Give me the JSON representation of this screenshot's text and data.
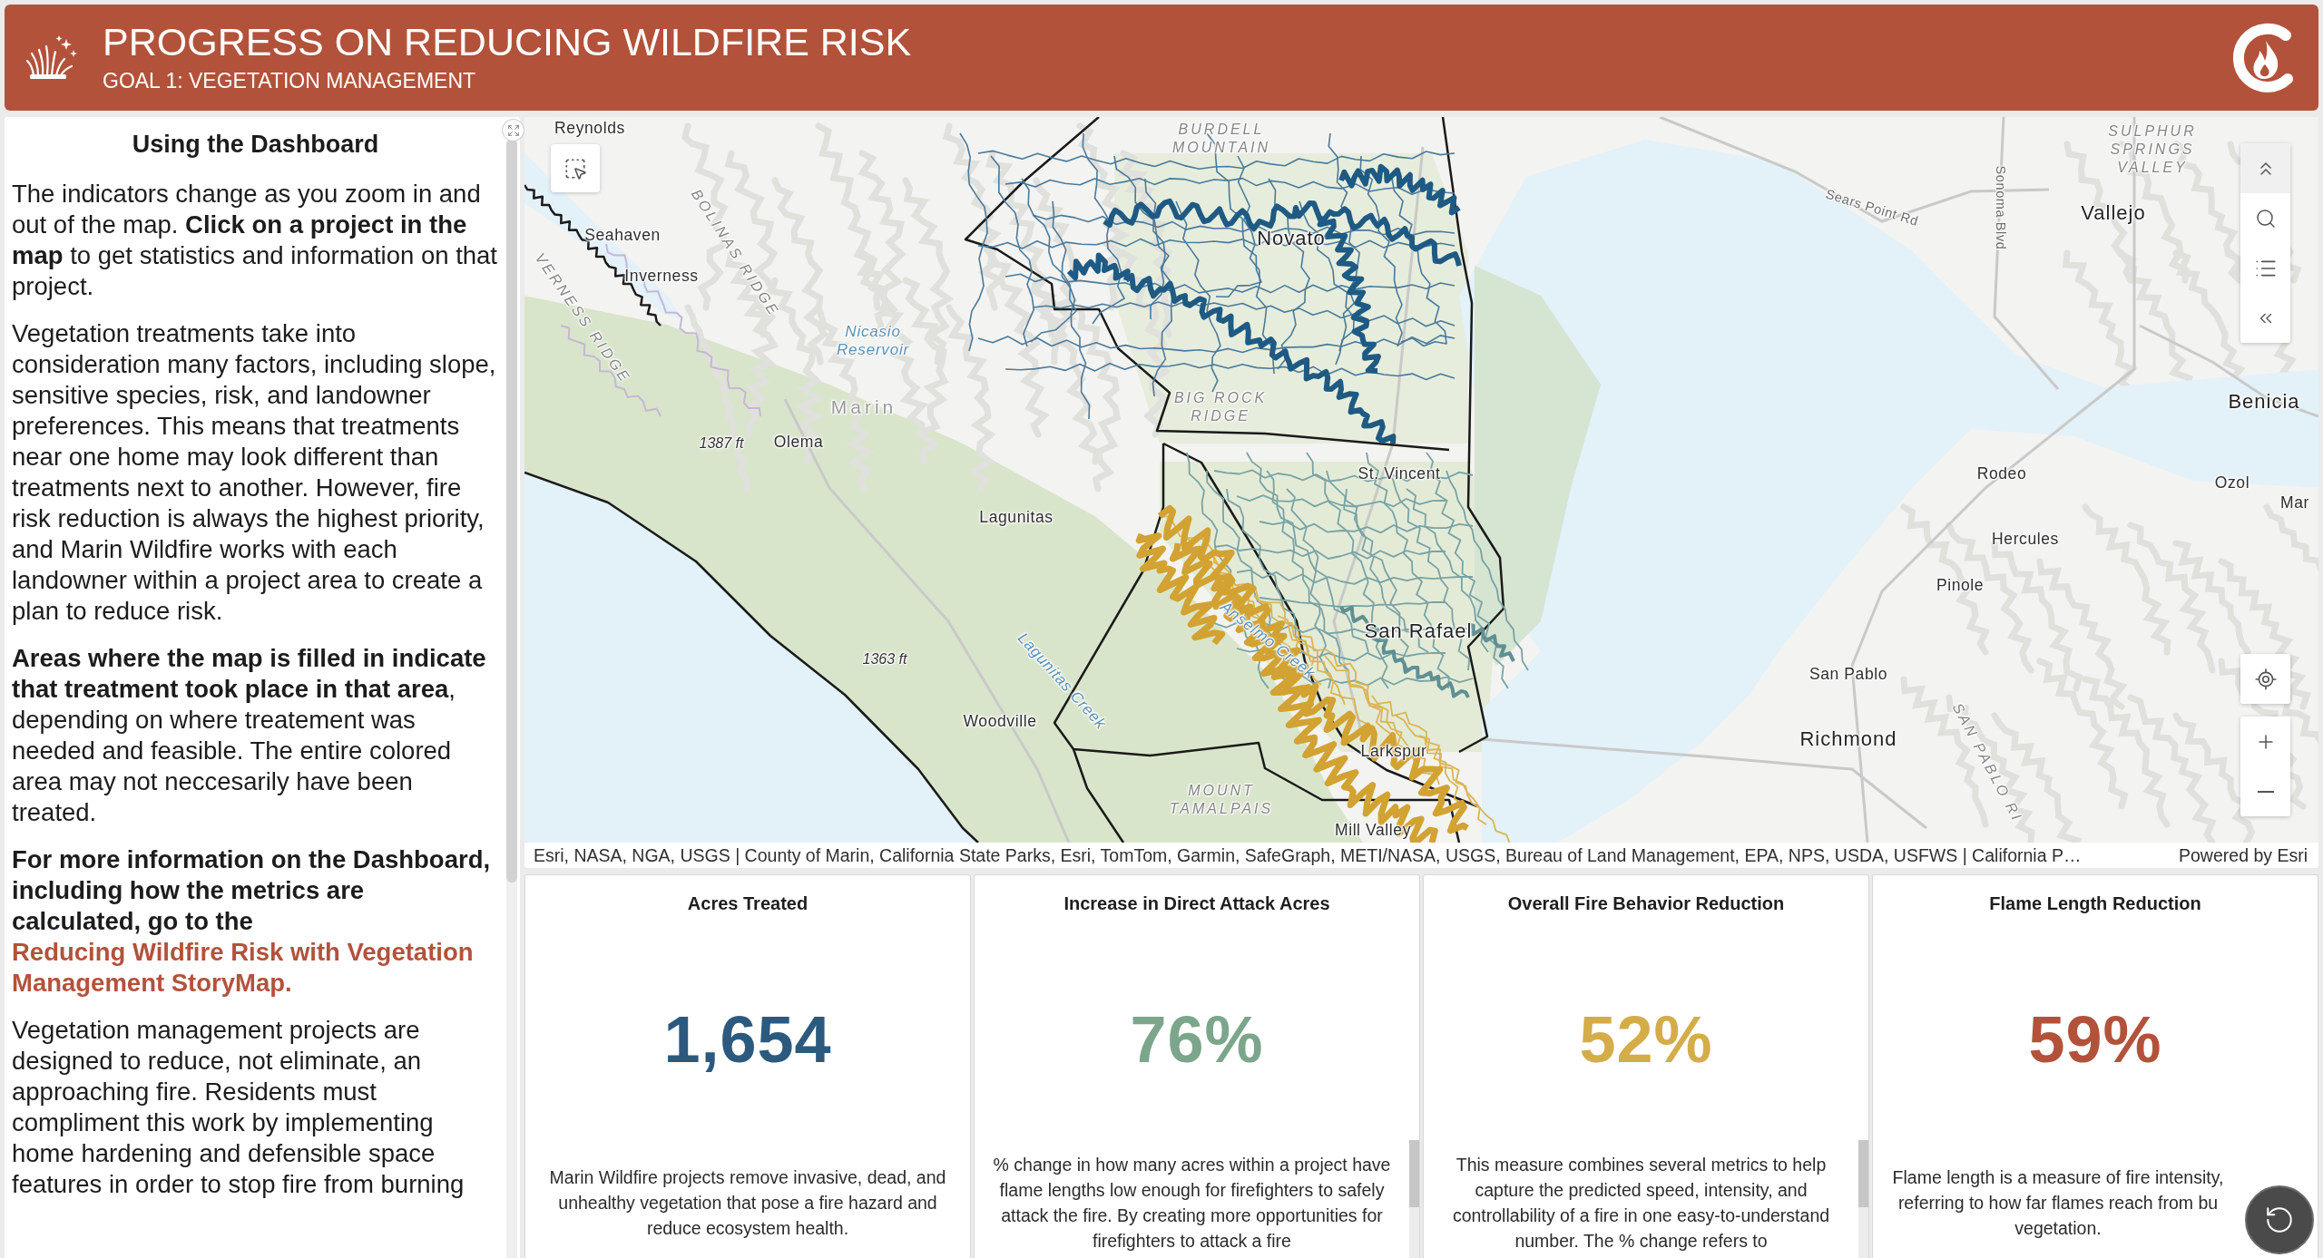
{
  "header": {
    "title": "PROGRESS ON REDUCING WILDFIRE RISK",
    "subtitle": "GOAL 1: VEGETATION MANAGEMENT"
  },
  "info_panel": {
    "heading": "Using the Dashboard",
    "paragraphs": [
      {
        "kind": "plain",
        "text": "The indicators change as you zoom in and out of the map. **Click on a project in the map** to get statistics and information on that project."
      },
      {
        "kind": "plain",
        "text": "Vegetation treatments take into consideration many factors, including slope, sensitive species, risk, and landowner preferences. This means that treatments near one home may look different than treatments next to another. However, fire risk reduction is always the highest priority, and Marin Wildfire works with each landowner within a project area to create a plan to reduce risk."
      },
      {
        "kind": "plain",
        "text": "**Areas where the map is filled in indicate that treatment took place in that area**, depending on where treatement was needed and feasible. The entire colored area may not neccesarily have been treated."
      },
      {
        "kind": "bold",
        "text": "For more information on the Dashboard, including how the metrics are calculated, go to the",
        "link": "Reducing Wildfire Risk with Vegetation Management StoryMap."
      },
      {
        "kind": "plain",
        "text": "Vegetation management projects are designed to reduce, not eliminate, an approaching fire. Residents must compliment this work by implementing home hardening and defensible space features in order to stop fire from burning"
      }
    ]
  },
  "map": {
    "labels": [
      {
        "text": "Reynolds",
        "kind": "town"
      },
      {
        "text": "BURDELL MOUNTAIN",
        "kind": "region"
      },
      {
        "text": "SULPHUR SPRINGS VALLEY",
        "kind": "region"
      },
      {
        "text": "Sears Point Rd",
        "kind": "road"
      },
      {
        "text": "Sonoma Blvd",
        "kind": "road"
      },
      {
        "text": "Vallejo",
        "kind": "city"
      },
      {
        "text": "Seahaven",
        "kind": "town"
      },
      {
        "text": "Novato",
        "kind": "city"
      },
      {
        "text": "BOLINAS RIDGE",
        "kind": "region"
      },
      {
        "text": "Inverness",
        "kind": "town"
      },
      {
        "text": "VERNESS RIDGE",
        "kind": "region"
      },
      {
        "text": "Nicasio Reservoir",
        "kind": "water"
      },
      {
        "text": "Marin",
        "kind": "county"
      },
      {
        "text": "BIG ROCK RIDGE",
        "kind": "region"
      },
      {
        "text": "Benicia",
        "kind": "city"
      },
      {
        "text": "Olema",
        "kind": "town"
      },
      {
        "text": "1387 ft",
        "kind": "elevation"
      },
      {
        "text": "St. Vincent",
        "kind": "town"
      },
      {
        "text": "Rodeo",
        "kind": "town"
      },
      {
        "text": "Ozol",
        "kind": "town"
      },
      {
        "text": "Mar",
        "kind": "town"
      },
      {
        "text": "Lagunitas",
        "kind": "town"
      },
      {
        "text": "Hercules",
        "kind": "town"
      },
      {
        "text": "Pinole",
        "kind": "town"
      },
      {
        "text": "San Rafael",
        "kind": "city"
      },
      {
        "text": "Anselmo Creek",
        "kind": "water"
      },
      {
        "text": "1363 ft",
        "kind": "elevation"
      },
      {
        "text": "San Pablo",
        "kind": "town"
      },
      {
        "text": "Lagunitas Creek",
        "kind": "water"
      },
      {
        "text": "Woodville",
        "kind": "town"
      },
      {
        "text": "Richmond",
        "kind": "city"
      },
      {
        "text": "Larkspur",
        "kind": "town"
      },
      {
        "text": "SAN PABLO RI",
        "kind": "region"
      },
      {
        "text": "MOUNT TAMALPAIS",
        "kind": "region"
      },
      {
        "text": "Mill Valley",
        "kind": "town"
      }
    ],
    "attribution": "Esri, NASA, NGA, USGS | County of Marin, California State Parks, Esri, TomTom, Garmin, SafeGraph, METI/NASA, USGS, Bureau of Land Management, EPA, NPS, USDA, USFWS | California P…",
    "powered_by": "Powered by Esri"
  },
  "metrics": [
    {
      "title": "Acres Treated",
      "value": "1,654",
      "color": "#2c5a7e",
      "description": "Marin Wildfire projects remove invasive, dead, and unhealthy vegetation that pose a fire hazard and reduce ecosystem health.",
      "scrollable": false
    },
    {
      "title": "Increase in Direct Attack Acres",
      "value": "76%",
      "color": "#7ba68c",
      "description": "% change in how many acres within a project have flame lengths low enough for firefighters to safely attack the fire. By creating more opportunities for firefighters to attack a fire",
      "scrollable": true
    },
    {
      "title": "Overall Fire Behavior Reduction",
      "value": "52%",
      "color": "#d4ad48",
      "description": "This measure combines several metrics to help capture the predicted speed, intensity, and controllability of a fire in one easy-to-understand number. The % change refers to",
      "scrollable": true
    },
    {
      "title": "Flame Length Reduction",
      "value": "59%",
      "color": "#b3523b",
      "description": "Flame length is a measure of fire intensity,\nreferring to how far flames reach from bu\nvegetation.",
      "scrollable": false
    }
  ]
}
